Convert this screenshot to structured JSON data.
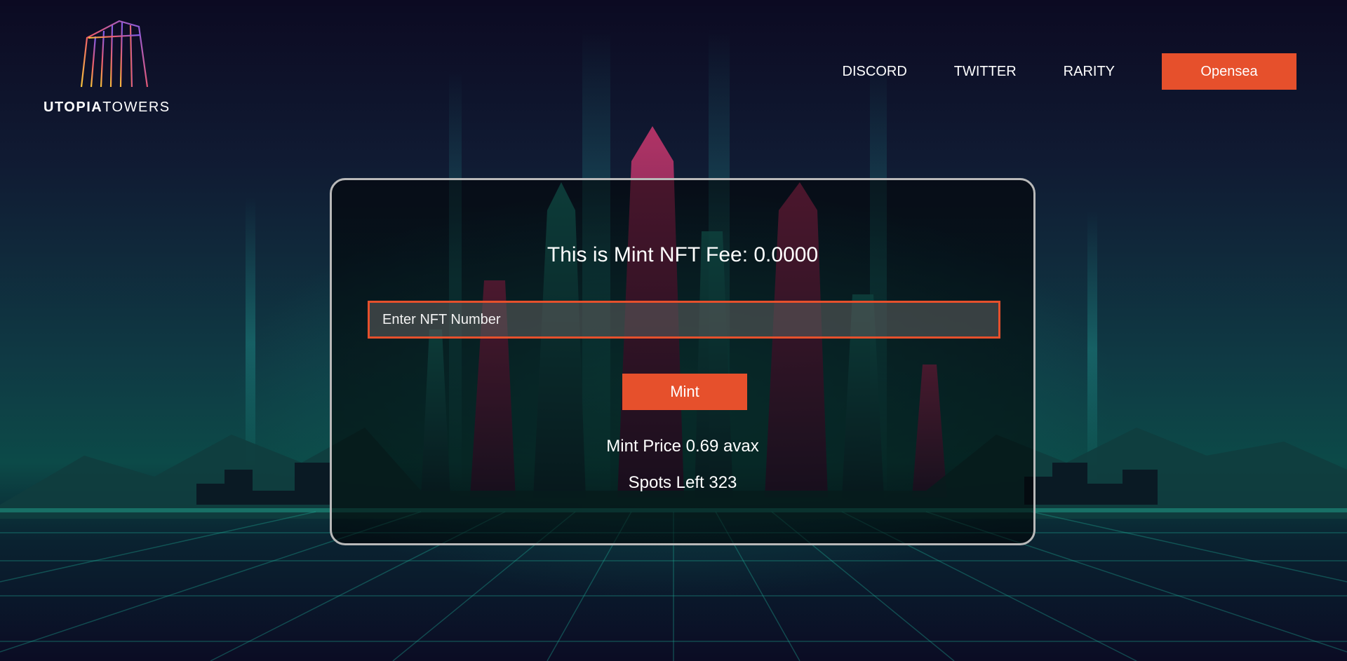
{
  "brand": {
    "name_part1": "UTOPIA",
    "name_part2": "TOWERS",
    "logo_icon": "tower-logo-icon"
  },
  "nav": {
    "links": [
      "DISCORD",
      "TWITTER",
      "RARITY"
    ],
    "cta_label": "Opensea"
  },
  "mint": {
    "fee_title": "This is Mint NFT Fee: 0.0000",
    "input_placeholder": "Enter NFT Number",
    "input_value": "",
    "button_label": "Mint",
    "price_text": "Mint Price 0.69 avax",
    "spots_text": "Spots Left 323"
  },
  "colors": {
    "accent": "#e6502c",
    "background": "#0b0820",
    "card_border": "#b9b9b9",
    "grid": "#1fb39a"
  }
}
